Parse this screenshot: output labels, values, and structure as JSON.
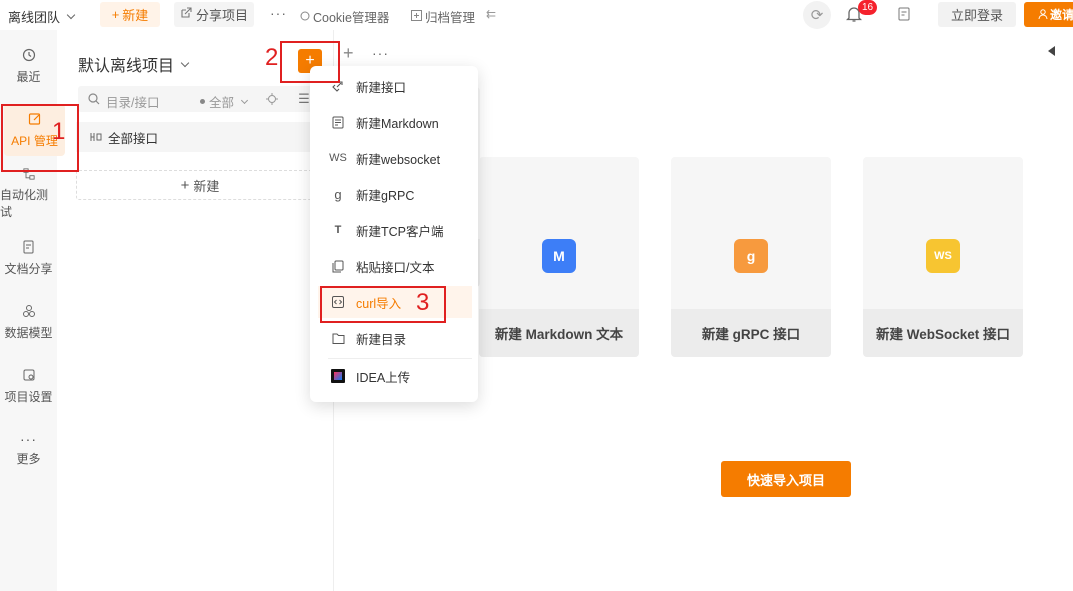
{
  "topbar": {
    "team": "离线团队",
    "new_label": "新建",
    "share_label": "分享项目",
    "more": "···",
    "cookie_label": "Cookie管理器",
    "archive_label": "归档管理",
    "badge_count": "16",
    "login_label": "立即登录",
    "invite_label": "邀请"
  },
  "leftnav": {
    "items": [
      {
        "label": "最近",
        "icon": "clock-icon"
      },
      {
        "label": "API 管理",
        "icon": "edit-icon"
      },
      {
        "label": "自动化测试",
        "icon": "flow-icon"
      },
      {
        "label": "文档分享",
        "icon": "doc-share-icon"
      },
      {
        "label": "数据模型",
        "icon": "model-icon"
      },
      {
        "label": "项目设置",
        "icon": "settings-icon"
      },
      {
        "label": "更多",
        "icon": "more-icon"
      }
    ]
  },
  "tree": {
    "project_title": "默认离线项目",
    "search_placeholder": "目录/接口",
    "filter_label": "全部",
    "all_api_label": "全部接口",
    "add_label": "新建"
  },
  "menu": {
    "items": [
      {
        "label": "新建接口",
        "icon": "link-icon"
      },
      {
        "label": "新建Markdown",
        "icon": "markdown-icon"
      },
      {
        "label": "新建websocket",
        "icon": "websocket-icon",
        "icon_text": "WS"
      },
      {
        "label": "新建gRPC",
        "icon": "grpc-icon",
        "icon_text": "g"
      },
      {
        "label": "新建TCP客户端",
        "icon": "tcp-icon",
        "icon_text": "T"
      },
      {
        "label": "粘贴接口/文本",
        "icon": "paste-icon"
      },
      {
        "label": "curl导入",
        "icon": "code-icon"
      },
      {
        "label": "新建目录",
        "icon": "folder-icon"
      },
      {
        "label": "IDEA上传",
        "icon": "idea-icon"
      }
    ]
  },
  "cards": [
    {
      "label": "新建 Markdown 文本",
      "icon": "markdown-card-icon",
      "icon_text": "M",
      "color": "#3d7ef7"
    },
    {
      "label": "新建 gRPC 接口",
      "icon": "grpc-card-icon",
      "icon_text": "g",
      "color": "#f79a3e"
    },
    {
      "label": "新建 WebSocket 接口",
      "icon": "websocket-card-icon",
      "icon_text": "WS",
      "color": "#f7c531"
    }
  ],
  "quick_import_label": "快速导入项目",
  "annotations": [
    "1",
    "2",
    "3"
  ],
  "colors": {
    "accent": "#f57c00",
    "annotation": "#e02020"
  }
}
